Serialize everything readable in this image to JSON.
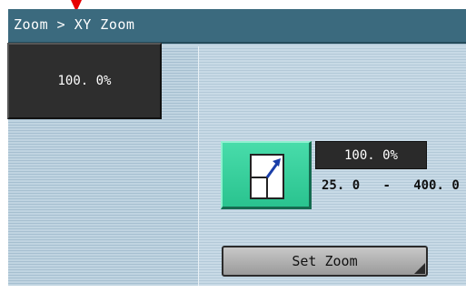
{
  "title": {
    "text": "Zoom > XY Zoom"
  },
  "zoom_display": {
    "value": "100. 0%"
  },
  "zoom_control": {
    "icon": "xy-zoom-icon",
    "value": "100. 0%",
    "range_min": "25. 0",
    "range_separator": "-",
    "range_max": "400. 0"
  },
  "buttons": {
    "set_zoom": "Set Zoom"
  },
  "colors": {
    "title_bar": "#3b6a7e",
    "zoom_button": "#2ac38f",
    "indicator": "#e60000",
    "display_bg": "#2e2e2e"
  }
}
